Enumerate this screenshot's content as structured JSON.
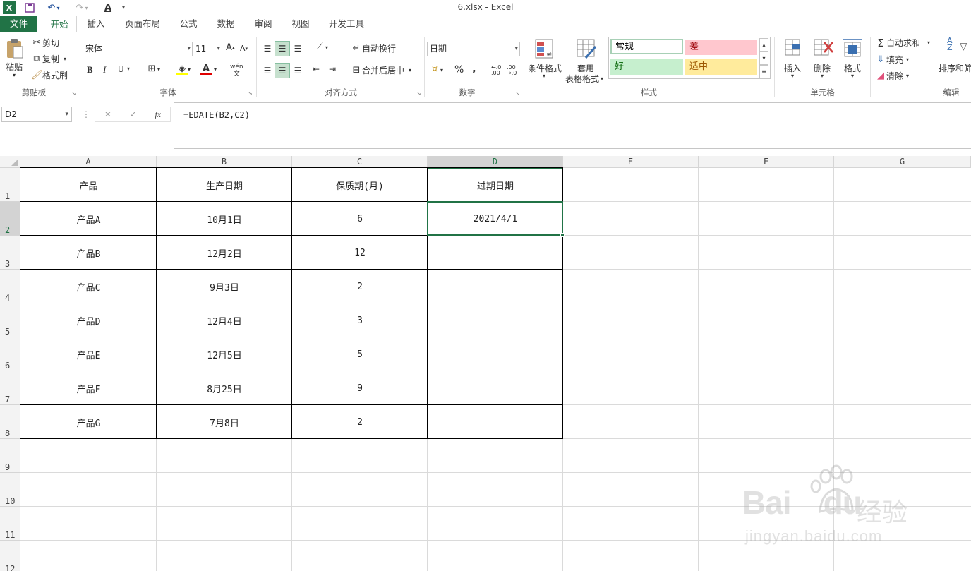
{
  "window": {
    "title": "6.xlsx - Excel"
  },
  "quick_access": {
    "undo_icon": "undo-icon",
    "redo_icon": "redo-icon"
  },
  "tabs": [
    "文件",
    "开始",
    "插入",
    "页面布局",
    "公式",
    "数据",
    "审阅",
    "视图",
    "开发工具"
  ],
  "ribbon": {
    "clipboard": {
      "paste": "粘贴",
      "cut": "剪切",
      "copy": "复制",
      "format_painter": "格式刷",
      "label": "剪贴板"
    },
    "font": {
      "name": "宋体",
      "size": "11",
      "bold": "B",
      "italic": "I",
      "underline": "U",
      "font_color_glyph": "A",
      "phonetic": "wén",
      "label": "字体"
    },
    "alignment": {
      "wrap_text": "自动换行",
      "merge_center": "合并后居中",
      "label": "对齐方式"
    },
    "number": {
      "format": "日期",
      "percent": "%",
      "comma": ",",
      "label": "数字"
    },
    "styles": {
      "conditional": "条件格式",
      "table_format_1": "套用",
      "table_format_2": "表格格式",
      "normal": "常规",
      "bad": "差",
      "good": "好",
      "neutral": "适中",
      "label": "样式"
    },
    "cells": {
      "insert": "插入",
      "delete": "删除",
      "format": "格式",
      "label": "单元格"
    },
    "editing": {
      "autosum": "自动求和",
      "fill": "填充",
      "clear": "清除",
      "sort_filter": "排序和筛",
      "label": "编辑"
    }
  },
  "formula_bar": {
    "name_box": "D2",
    "cancel": "✕",
    "enter": "✓",
    "fx": "fx",
    "formula": "=EDATE(B2,C2)"
  },
  "columns": [
    "A",
    "B",
    "C",
    "D",
    "E",
    "F",
    "G"
  ],
  "rows": [
    "1",
    "2",
    "3",
    "4",
    "5",
    "6",
    "7",
    "8",
    "9",
    "10",
    "11",
    "12"
  ],
  "selected": {
    "cell": "D2",
    "column": "D",
    "row": "2"
  },
  "table": [
    [
      "产品",
      "生产日期",
      "保质期(月)",
      "过期日期"
    ],
    [
      "产品A",
      "10月1日",
      "6",
      "2021/4/1"
    ],
    [
      "产品B",
      "12月2日",
      "12",
      ""
    ],
    [
      "产品C",
      "9月3日",
      "2",
      ""
    ],
    [
      "产品D",
      "12月4日",
      "3",
      ""
    ],
    [
      "产品E",
      "12月5日",
      "5",
      ""
    ],
    [
      "产品F",
      "8月25日",
      "9",
      ""
    ],
    [
      "产品G",
      "7月8日",
      "2",
      ""
    ]
  ],
  "watermark": {
    "brand": "Bai",
    "brand2": "du",
    "cn": "经验",
    "url": "jingyan.baidu.com"
  },
  "colors": {
    "accent": "#217346",
    "bad_bg": "#ffc7ce",
    "good_bg": "#c6efce",
    "neutral_bg": "#ffeb9c"
  }
}
